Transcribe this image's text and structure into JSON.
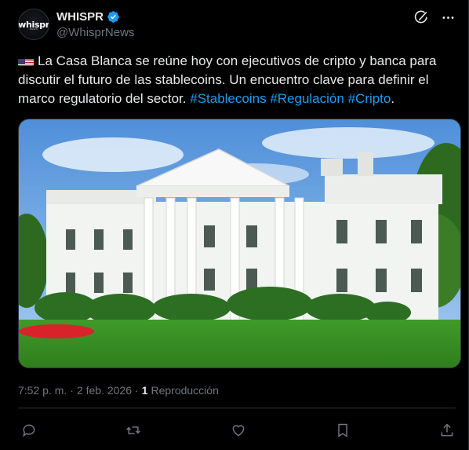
{
  "account": {
    "display_name": "WHISPR",
    "handle": "@WhisprNews",
    "avatar_text": "whispr",
    "avatar_subtext": "NEWS"
  },
  "header_icons": [
    "grok-icon",
    "more-icon"
  ],
  "tweet": {
    "text_main": "La Casa Blanca se reúne hoy con ejecutivos de cripto y banca para discutir el futuro de las stablecoins. Un encuentro clave para definir el marco regulatorio del sector.",
    "hashtags": [
      "#Stablecoins",
      "#Regulación",
      "#Cripto"
    ],
    "trailing": ".",
    "flag_icon": "us-flag-icon"
  },
  "meta": {
    "time": "7:52 p. m.",
    "separator": "·",
    "date": "2 feb. 2026",
    "separator2": "·",
    "views_count": "1",
    "views_label": "Reproducción"
  },
  "actions": [
    "reply-icon",
    "retweet-icon",
    "like-icon",
    "bookmark-icon",
    "share-icon"
  ],
  "colors": {
    "background": "#000000",
    "text": "#e7e9ea",
    "secondary": "#71767b",
    "link": "#1d9bf0",
    "verified": "#1d9bf0"
  }
}
